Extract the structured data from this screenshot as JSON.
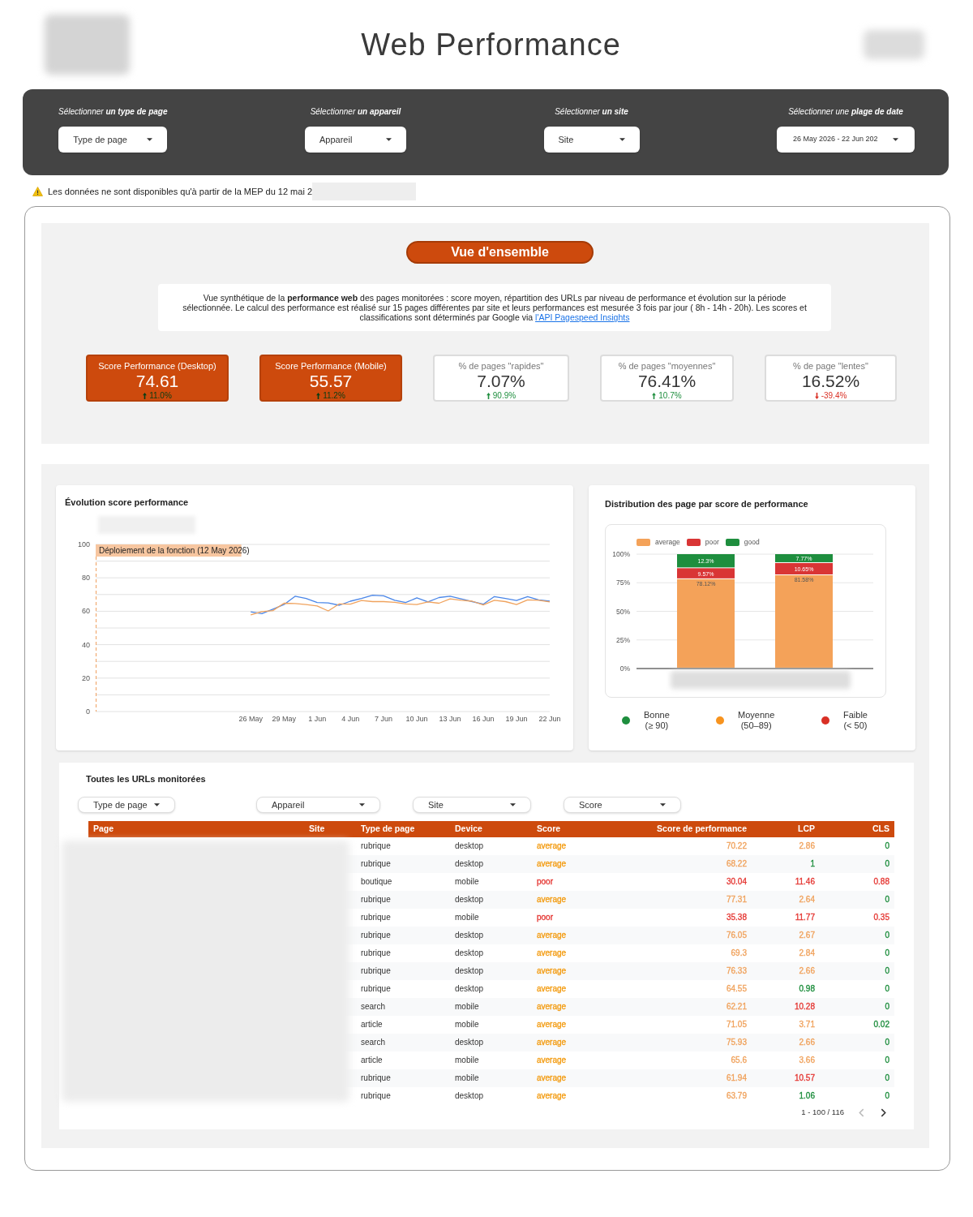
{
  "header": {
    "title": "Web Performance"
  },
  "filters": [
    {
      "kind": "select",
      "label": "Sélectionner **un type de page**",
      "value": "Type de page"
    },
    {
      "kind": "select",
      "label": "Sélectionner **un appareil**",
      "value": "Appareil"
    },
    {
      "kind": "select",
      "label": "Sélectionner **un site**",
      "value": "Site"
    },
    {
      "kind": "date_range",
      "label": "Sélectionner une **plage de date**",
      "value": "26 May 2026 - 22 Jun 202"
    }
  ],
  "notice": {
    "text": "Les données ne sont disponibles qu'à partir de la MEP du 12 mai 2"
  },
  "overview": {
    "heading": "Vue d'ensemble",
    "description": "Vue synthétique de la **performance web** des pages monitorées : score moyen, répartition des URLs par niveau de performance et évolution sur la période sélectionnée. Le calcul des performance est réalisé sur 15 pages différentes par site et leurs performances est mesurée 3 fois par jour ( 8h - 14h - 20h). Les scores et classifications sont déterminés par Google via ",
    "link": "l'API Pagespeed Insights",
    "kpis": [
      {
        "kind": "filled",
        "title": "Score Performance (Desktop)",
        "value": "74.61",
        "rising": true,
        "delta": "11.0%"
      },
      {
        "kind": "filled",
        "title": "Score Performance (Mobile)",
        "value": "55.57",
        "rising": true,
        "delta": "11.2%"
      },
      {
        "kind": "outlined",
        "title": "% de pages \"rapides\"",
        "value": "7.07%",
        "rising": true,
        "delta": "90.9%"
      },
      {
        "kind": "outlined",
        "title": "% de pages \"moyennes\"",
        "value": "76.41%",
        "rising": true,
        "delta": "10.7%"
      },
      {
        "kind": "outlined",
        "title": "% de page \"lentes\"",
        "value": "16.52%",
        "rising": false,
        "delta": "-39.4%"
      }
    ]
  },
  "line_chart": {
    "title": "Évolution score performance",
    "chart_data": {
      "type": "line",
      "categories": [
        null,
        null,
        null,
        null,
        null,
        null,
        null,
        null,
        null,
        null,
        null,
        null,
        null,
        null,
        "26 May",
        null,
        null,
        "29 May",
        null,
        null,
        "1 Jun",
        null,
        null,
        "4 Jun",
        null,
        null,
        "7 Jun",
        null,
        null,
        "10 Jun",
        null,
        null,
        "13 Jun",
        null,
        null,
        "16 Jun",
        null,
        null,
        "19 Jun",
        null,
        null,
        "22 Jun"
      ],
      "ylim": [
        0,
        100
      ],
      "yticks": [
        0,
        20,
        40,
        60,
        80,
        100
      ],
      "grid": true,
      "series": [
        {
          "color": "#4a86e8",
          "values": [
            null,
            null,
            null,
            null,
            null,
            null,
            null,
            null,
            null,
            null,
            null,
            null,
            null,
            null,
            59.6,
            58.6,
            61.2,
            64,
            69,
            67.6,
            65.2,
            65,
            63.6,
            66,
            67.6,
            69.6,
            69.2,
            66.6,
            65.2,
            68,
            65.6,
            68.2,
            69,
            67.4,
            65.8,
            64.2,
            68.8,
            67.6,
            66.4,
            68.8,
            66.8,
            66
          ]
        },
        {
          "color": "#f0a35e",
          "values": [
            null,
            null,
            null,
            null,
            null,
            null,
            null,
            null,
            null,
            null,
            null,
            null,
            null,
            null,
            57.8,
            59.8,
            60.4,
            64.8,
            64.6,
            64,
            63.2,
            60.2,
            64.4,
            64.2,
            66.4,
            65.8,
            65.8,
            65.4,
            64.4,
            64,
            65.6,
            64.8,
            67.4,
            66.6,
            66,
            63.8,
            66.6,
            65.8,
            64,
            66.8,
            66.6,
            65.6
          ]
        }
      ],
      "annotations": [
        "Déploiement de la fonction (12 May 2026)"
      ]
    }
  },
  "distribution_chart": {
    "title": "Distribution des page par score de performance",
    "chart_data": {
      "type": "bar",
      "stacked": true,
      "legend": "top",
      "grid": true,
      "ylim": [
        0,
        100
      ],
      "yticks": [
        {
          "value": 0,
          "label": "0%"
        },
        {
          "value": 25,
          "label": "25%"
        },
        {
          "value": 50,
          "label": "50%"
        },
        {
          "value": 75,
          "label": "75%"
        },
        {
          "value": 100,
          "label": "100%"
        }
      ],
      "series": [
        {
          "name": "average",
          "color": "#f4a259",
          "values": [
            78.12,
            81.58
          ],
          "value_labels": [
            "78.12%",
            "81.58%"
          ]
        },
        {
          "name": "poor",
          "color": "#d93535",
          "values": [
            9.57,
            10.65
          ],
          "value_labels": [
            "9.57%",
            "10.65%"
          ]
        },
        {
          "name": "good",
          "color": "#1e8e3e",
          "values": [
            12.3,
            7.77
          ],
          "value_labels": [
            "12.3%",
            "7.77%"
          ]
        }
      ]
    },
    "legend": [
      {
        "label": "Bonne",
        "range": "(≥ 90)",
        "color": "#1e8e3e"
      },
      {
        "label": "Moyenne",
        "range": "(50–89)",
        "color": "#f7931e"
      },
      {
        "label": "Faible",
        "range": "(< 50)",
        "color": "#d93025"
      }
    ]
  },
  "url_table": {
    "title": "Toutes les URLs monitorées",
    "filters": [
      "Type de page",
      "Appareil",
      "Site",
      "Score"
    ],
    "columns": [
      "Page",
      "Site",
      "Type de page",
      "Device",
      "Score",
      "Score de performance",
      "LCP",
      "CLS"
    ],
    "rows": [
      {
        "type": "rubrique",
        "device": "desktop",
        "score": {
          "text": "average",
          "color": "#f39c12"
        },
        "performance": {
          "text": "70.22",
          "color": "#f0a35e"
        },
        "lcp": {
          "text": "2.86",
          "color": "#f0a35e"
        },
        "cls": {
          "text": "0",
          "color": "#1e8e3e"
        }
      },
      {
        "type": "rubrique",
        "device": "desktop",
        "score": {
          "text": "average",
          "color": "#f39c12"
        },
        "performance": {
          "text": "68.22",
          "color": "#f0a35e"
        },
        "lcp": {
          "text": "1",
          "color": "#1e8e3e"
        },
        "cls": {
          "text": "0",
          "color": "#1e8e3e"
        }
      },
      {
        "type": "boutique",
        "device": "mobile",
        "score": {
          "text": "poor",
          "color": "#e53935"
        },
        "performance": {
          "text": "30.04",
          "color": "#e53935"
        },
        "lcp": {
          "text": "11.46",
          "color": "#e53935"
        },
        "cls": {
          "text": "0.88",
          "color": "#e53935"
        }
      },
      {
        "type": "rubrique",
        "device": "desktop",
        "score": {
          "text": "average",
          "color": "#f39c12"
        },
        "performance": {
          "text": "77.31",
          "color": "#f0a35e"
        },
        "lcp": {
          "text": "2.64",
          "color": "#f0a35e"
        },
        "cls": {
          "text": "0",
          "color": "#1e8e3e"
        }
      },
      {
        "type": "rubrique",
        "device": "mobile",
        "score": {
          "text": "poor",
          "color": "#e53935"
        },
        "performance": {
          "text": "35.38",
          "color": "#e53935"
        },
        "lcp": {
          "text": "11.77",
          "color": "#e53935"
        },
        "cls": {
          "text": "0.35",
          "color": "#e53935"
        }
      },
      {
        "type": "rubrique",
        "device": "desktop",
        "score": {
          "text": "average",
          "color": "#f39c12"
        },
        "performance": {
          "text": "76.05",
          "color": "#f0a35e"
        },
        "lcp": {
          "text": "2.67",
          "color": "#f0a35e"
        },
        "cls": {
          "text": "0",
          "color": "#1e8e3e"
        }
      },
      {
        "type": "rubrique",
        "device": "desktop",
        "score": {
          "text": "average",
          "color": "#f39c12"
        },
        "performance": {
          "text": "69.3",
          "color": "#f0a35e"
        },
        "lcp": {
          "text": "2.84",
          "color": "#f0a35e"
        },
        "cls": {
          "text": "0",
          "color": "#1e8e3e"
        }
      },
      {
        "type": "rubrique",
        "device": "desktop",
        "score": {
          "text": "average",
          "color": "#f39c12"
        },
        "performance": {
          "text": "76.33",
          "color": "#f0a35e"
        },
        "lcp": {
          "text": "2.66",
          "color": "#f0a35e"
        },
        "cls": {
          "text": "0",
          "color": "#1e8e3e"
        }
      },
      {
        "type": "rubrique",
        "device": "desktop",
        "score": {
          "text": "average",
          "color": "#f39c12"
        },
        "performance": {
          "text": "64.55",
          "color": "#f0a35e"
        },
        "lcp": {
          "text": "0.98",
          "color": "#1e8e3e"
        },
        "cls": {
          "text": "0",
          "color": "#1e8e3e"
        }
      },
      {
        "type": "search",
        "device": "mobile",
        "score": {
          "text": "average",
          "color": "#f39c12"
        },
        "performance": {
          "text": "62.21",
          "color": "#f0a35e"
        },
        "lcp": {
          "text": "10.28",
          "color": "#e53935"
        },
        "cls": {
          "text": "0",
          "color": "#1e8e3e"
        }
      },
      {
        "type": "article",
        "device": "mobile",
        "score": {
          "text": "average",
          "color": "#f39c12"
        },
        "performance": {
          "text": "71.05",
          "color": "#f0a35e"
        },
        "lcp": {
          "text": "3.71",
          "color": "#f0a35e"
        },
        "cls": {
          "text": "0.02",
          "color": "#1e8e3e"
        }
      },
      {
        "type": "search",
        "device": "desktop",
        "score": {
          "text": "average",
          "color": "#f39c12"
        },
        "performance": {
          "text": "75.93",
          "color": "#f0a35e"
        },
        "lcp": {
          "text": "2.66",
          "color": "#f0a35e"
        },
        "cls": {
          "text": "0",
          "color": "#1e8e3e"
        }
      },
      {
        "type": "article",
        "device": "mobile",
        "score": {
          "text": "average",
          "color": "#f39c12"
        },
        "performance": {
          "text": "65.6",
          "color": "#f0a35e"
        },
        "lcp": {
          "text": "3.66",
          "color": "#f0a35e"
        },
        "cls": {
          "text": "0",
          "color": "#1e8e3e"
        }
      },
      {
        "type": "rubrique",
        "device": "mobile",
        "score": {
          "text": "average",
          "color": "#f39c12"
        },
        "performance": {
          "text": "61.94",
          "color": "#f0a35e"
        },
        "lcp": {
          "text": "10.57",
          "color": "#e53935"
        },
        "cls": {
          "text": "0",
          "color": "#1e8e3e"
        }
      },
      {
        "type": "rubrique",
        "device": "desktop",
        "score": {
          "text": "average",
          "color": "#f39c12"
        },
        "performance": {
          "text": "63.79",
          "color": "#f0a35e"
        },
        "lcp": {
          "text": "1.06",
          "color": "#1e8e3e"
        },
        "cls": {
          "text": "0",
          "color": "#1e8e3e"
        }
      }
    ],
    "pagination": {
      "range": "1 - 100 / 116",
      "previous": {
        "disabled": true
      },
      "next": {
        "disabled": false
      }
    }
  }
}
